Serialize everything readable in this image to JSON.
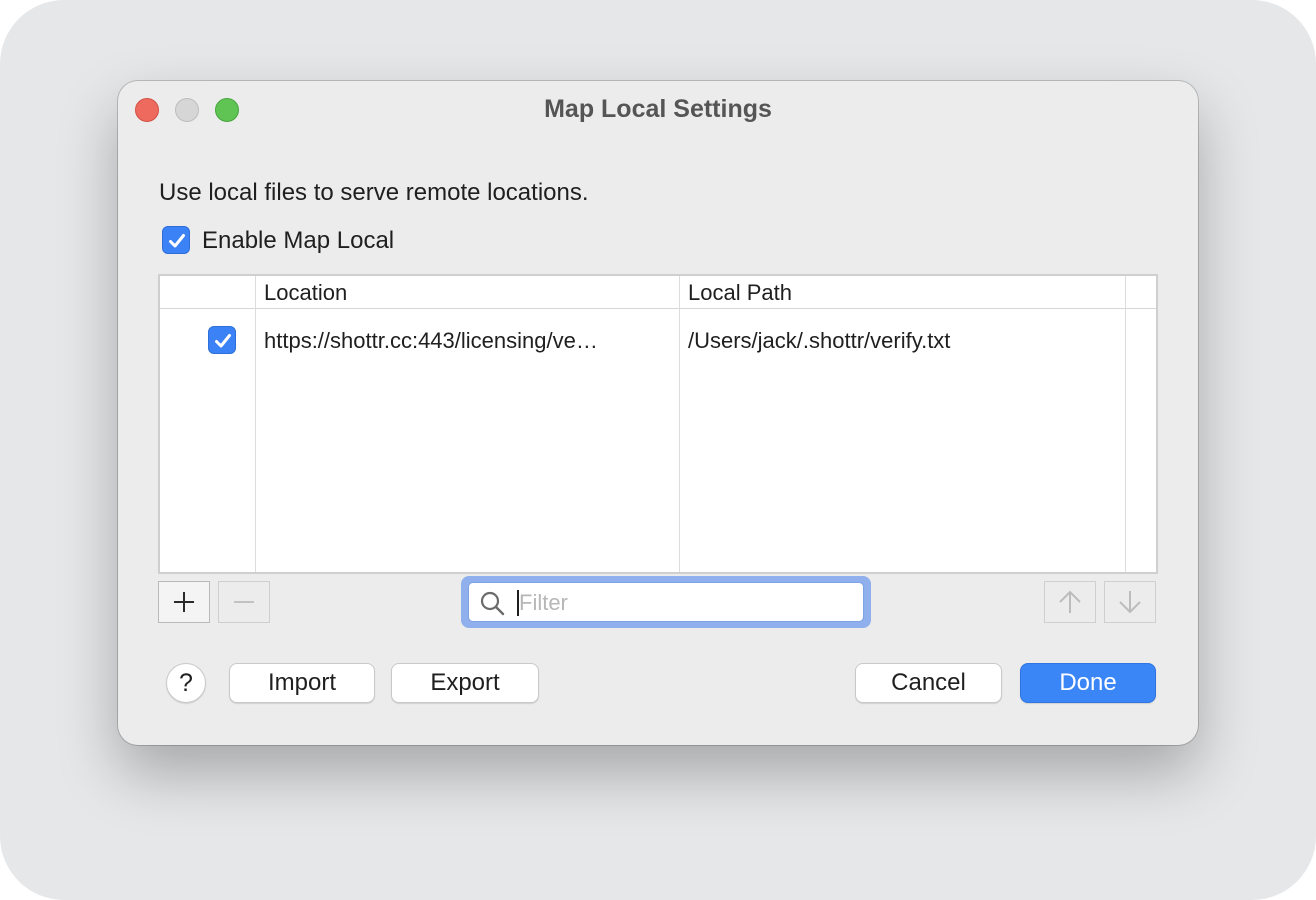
{
  "window": {
    "title": "Map Local Settings"
  },
  "description": "Use local files to serve remote locations.",
  "enable": {
    "label": "Enable Map Local",
    "checked": true
  },
  "table": {
    "columns": [
      "Location",
      "Local Path"
    ],
    "rows": [
      {
        "enabled": true,
        "location": "https://shottr.cc:443/licensing/ve…",
        "local_path": "/Users/jack/.shottr/verify.txt"
      }
    ]
  },
  "toolbar": {
    "add_icon": "plus-icon",
    "remove_icon": "minus-icon",
    "move_up_icon": "arrow-up-icon",
    "move_down_icon": "arrow-down-icon"
  },
  "filter": {
    "placeholder": "Filter",
    "value": ""
  },
  "footer": {
    "help_label": "?",
    "import_label": "Import",
    "export_label": "Export",
    "cancel_label": "Cancel",
    "done_label": "Done"
  },
  "colors": {
    "accent": "#3a86f7",
    "close": "#ee6a5e",
    "minimize": "#d6d6d6",
    "zoom": "#5fc454"
  }
}
